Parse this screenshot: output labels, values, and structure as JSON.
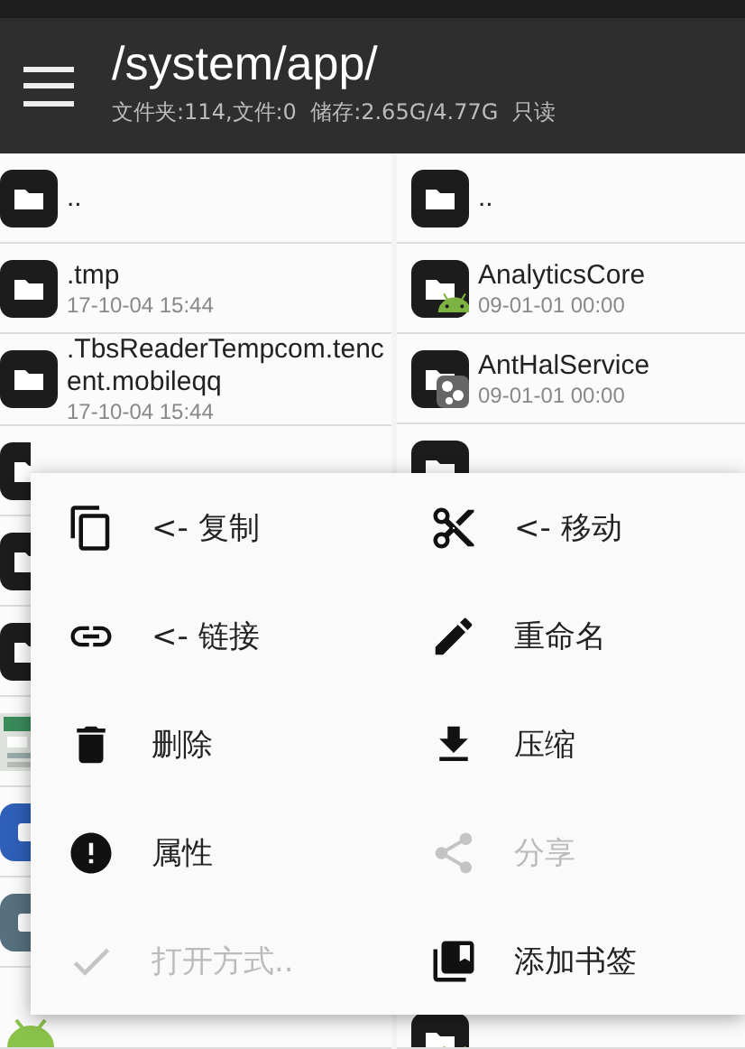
{
  "toolbar": {
    "title": "/system/app/",
    "subtitle": "文件夹:114,文件:0  储存:2.65G/4.77G  只读"
  },
  "left_pane": {
    "rows": [
      {
        "kind": "folder",
        "name": ".."
      },
      {
        "kind": "folder",
        "name": ".tmp",
        "date": "17-10-04 15:44"
      },
      {
        "kind": "folder",
        "name": ".TbsReaderTempcom.tencent.mobileqq",
        "date": "17-10-04 15:44"
      },
      {
        "kind": "folder"
      },
      {
        "kind": "folder"
      },
      {
        "kind": "folder"
      },
      {
        "kind": "picture"
      },
      {
        "kind": "app",
        "color": "#2f5fb8"
      },
      {
        "kind": "app",
        "color": "#56707e"
      },
      {
        "kind": "apk"
      }
    ]
  },
  "right_pane": {
    "rows": [
      {
        "kind": "folder",
        "name": ".."
      },
      {
        "kind": "android-folder",
        "name": "AnalyticsCore",
        "date": "09-01-01 00:00"
      },
      {
        "kind": "service-folder",
        "name": "AntHalService",
        "date": "09-01-01 00:00"
      },
      {
        "kind": "folder"
      },
      {
        "kind": "android-folder"
      }
    ]
  },
  "menu": {
    "items": [
      {
        "kind": "copy",
        "label": "<- 复制",
        "disabled": false
      },
      {
        "kind": "cut",
        "label": "<- 移动",
        "disabled": false
      },
      {
        "kind": "link",
        "label": "<- 链接",
        "disabled": false
      },
      {
        "kind": "edit",
        "label": "重命名",
        "disabled": false
      },
      {
        "kind": "delete",
        "label": "删除",
        "disabled": false
      },
      {
        "kind": "download",
        "label": "压缩",
        "disabled": false
      },
      {
        "kind": "info",
        "label": "属性",
        "disabled": false
      },
      {
        "kind": "share",
        "label": "分享",
        "disabled": true
      },
      {
        "kind": "check",
        "label": "打开方式..",
        "disabled": true
      },
      {
        "kind": "bookmark",
        "label": "添加书签",
        "disabled": false
      }
    ]
  }
}
